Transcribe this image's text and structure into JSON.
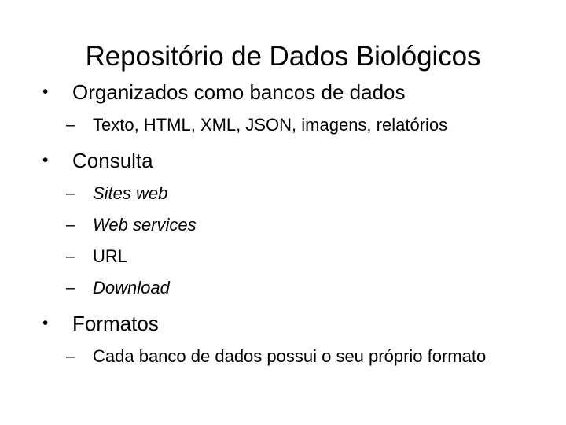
{
  "slide": {
    "title": "Repositório de Dados Biológicos",
    "background_color": "#ffffff",
    "text_color": "#000000",
    "bullet_marker_level1": "•",
    "bullet_marker_level2": "–",
    "blocks": [
      {
        "level": 1,
        "text": "Organizados como bancos de dados",
        "children": [
          {
            "level": 2,
            "text": "Texto, HTML, XML, JSON, imagens, relatórios",
            "italic": false,
            "justified": false
          }
        ]
      },
      {
        "level": 1,
        "text": "Consulta",
        "children": [
          {
            "level": 2,
            "text": "Sites web",
            "italic": true,
            "justified": false
          },
          {
            "level": 2,
            "text": "Web services",
            "italic": true,
            "justified": false
          },
          {
            "level": 2,
            "text": "URL",
            "italic": false,
            "justified": false
          },
          {
            "level": 2,
            "text": "Download",
            "italic": true,
            "justified": false
          }
        ]
      },
      {
        "level": 1,
        "text": "Formatos",
        "children": [
          {
            "level": 2,
            "text": "Cada banco de dados possui o seu próprio formato",
            "italic": false,
            "justified": true
          }
        ]
      }
    ]
  }
}
